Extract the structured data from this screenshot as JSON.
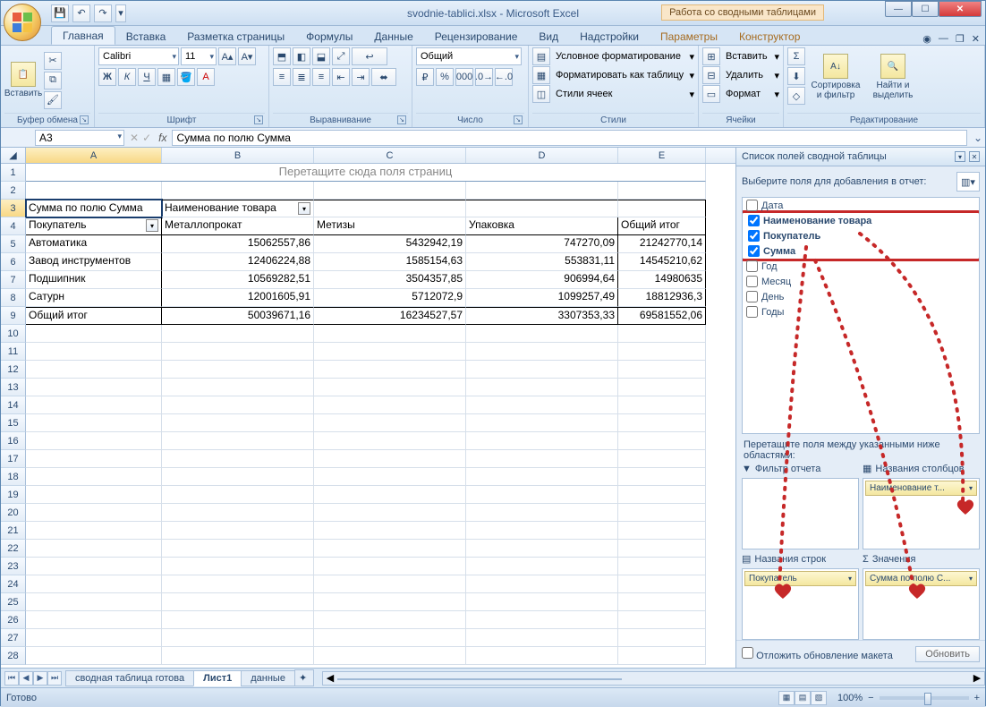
{
  "window": {
    "title": "svodnie-tablici.xlsx - Microsoft Excel",
    "context_label": "Работа со сводными таблицами"
  },
  "quick_access": [
    "save",
    "undo",
    "redo"
  ],
  "ribbon_tabs": [
    "Главная",
    "Вставка",
    "Разметка страницы",
    "Формулы",
    "Данные",
    "Рецензирование",
    "Вид",
    "Надстройки"
  ],
  "ribbon_ctx_tabs": [
    "Параметры",
    "Конструктор"
  ],
  "ribbon_active": "Главная",
  "ribbon": {
    "clipboard": {
      "paste": "Вставить",
      "label": "Буфер обмена"
    },
    "font": {
      "name": "Calibri",
      "size": "11",
      "label": "Шрифт"
    },
    "alignment": {
      "label": "Выравнивание"
    },
    "number": {
      "format": "Общий",
      "label": "Число"
    },
    "styles": {
      "cond": "Условное форматирование",
      "table": "Форматировать как таблицу",
      "cell": "Стили ячеек",
      "label": "Стили"
    },
    "cells": {
      "insert": "Вставить",
      "delete": "Удалить",
      "format": "Формат",
      "label": "Ячейки"
    },
    "editing": {
      "sort": "Сортировка и фильтр",
      "find": "Найти и выделить",
      "label": "Редактирование"
    }
  },
  "formula_bar": {
    "cell_ref": "A3",
    "formula": "Сумма по полю Сумма"
  },
  "columns": [
    "A",
    "B",
    "C",
    "D",
    "E"
  ],
  "pivot": {
    "page_hint": "Перетащите сюда поля страниц",
    "data_label": "Сумма по полю Сумма",
    "col_field_label": "Наименование товара",
    "row_field_label": "Покупатель",
    "col_headers": [
      "Металлопрокат",
      "Метизы",
      "Упаковка",
      "Общий итог"
    ],
    "rows": [
      {
        "label": "Автоматика",
        "v": [
          "15062557,86",
          "5432942,19",
          "747270,09",
          "21242770,14"
        ]
      },
      {
        "label": "Завод инструментов",
        "v": [
          "12406224,88",
          "1585154,63",
          "553831,11",
          "14545210,62"
        ]
      },
      {
        "label": "Подшипник",
        "v": [
          "10569282,51",
          "3504357,85",
          "906994,64",
          "14980635"
        ]
      },
      {
        "label": "Сатурн",
        "v": [
          "12001605,91",
          "5712072,9",
          "1099257,49",
          "18812936,3"
        ]
      },
      {
        "label": "Общий итог",
        "v": [
          "50039671,16",
          "16234527,57",
          "3307353,33",
          "69581552,06"
        ]
      }
    ]
  },
  "sheet_tabs": [
    "сводная таблица готова",
    "Лист1",
    "данные"
  ],
  "sheet_active": "Лист1",
  "field_list": {
    "title": "Список полей сводной таблицы",
    "hint": "Выберите поля для добавления в отчет:",
    "fields": [
      {
        "name": "Дата",
        "checked": false
      },
      {
        "name": "Наименование товара",
        "checked": true
      },
      {
        "name": "Покупатель",
        "checked": true
      },
      {
        "name": "Сумма",
        "checked": true
      },
      {
        "name": "Год",
        "checked": false
      },
      {
        "name": "Месяц",
        "checked": false
      },
      {
        "name": "День",
        "checked": false
      },
      {
        "name": "Годы",
        "checked": false
      }
    ],
    "areas_hint": "Перетащите поля между указанными ниже областями:",
    "area_labels": {
      "filter": "Фильтр отчета",
      "cols": "Названия столбцов",
      "rows": "Названия строк",
      "vals": "Значения"
    },
    "area_cols_pill": "Наименование т...",
    "area_rows_pill": "Покупатель",
    "area_vals_pill": "Сумма по полю С...",
    "defer_label": "Отложить обновление макета",
    "update_btn": "Обновить"
  },
  "status": {
    "ready": "Готово",
    "zoom": "100%"
  }
}
